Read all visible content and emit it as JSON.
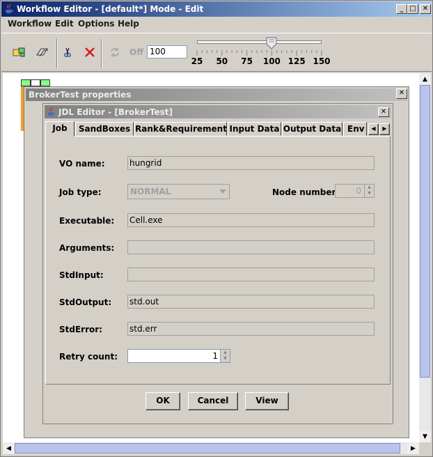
{
  "window": {
    "title": "Workflow Editor - [default*] Mode - Edit"
  },
  "menu": [
    "Workflow",
    "Edit",
    "Options",
    "Help"
  ],
  "toolbar": {
    "off_label": "Off",
    "zoom_value": "100",
    "slider_ticks": [
      "25",
      "50",
      "75",
      "100",
      "125",
      "150"
    ],
    "slider_level": 100
  },
  "internal_frame": {
    "title": "BrokerTest properties"
  },
  "dialog": {
    "title": "JDL Editor - [BrokerTest]",
    "tabs": [
      "Job",
      "SandBoxes",
      "Rank&Requirement",
      "Input Data",
      "Output Data",
      "Env"
    ],
    "active_tab": "Job",
    "fields": {
      "vo_name": {
        "label": "VO name:",
        "value": "hungrid"
      },
      "job_type": {
        "label": "Job type:",
        "value": "NORMAL"
      },
      "node_number": {
        "label": "Node number:",
        "value": "0"
      },
      "executable": {
        "label": "Executable:",
        "value": "Cell.exe"
      },
      "arguments": {
        "label": "Arguments:",
        "value": ""
      },
      "stdinput": {
        "label": "StdInput:",
        "value": ""
      },
      "stdoutput": {
        "label": "StdOutput:",
        "value": "std.out"
      },
      "stderror": {
        "label": "StdError:",
        "value": "std.err"
      },
      "retry_count": {
        "label": "Retry count:",
        "value": "1"
      }
    },
    "buttons": {
      "ok": "OK",
      "cancel": "Cancel",
      "view": "View"
    }
  }
}
